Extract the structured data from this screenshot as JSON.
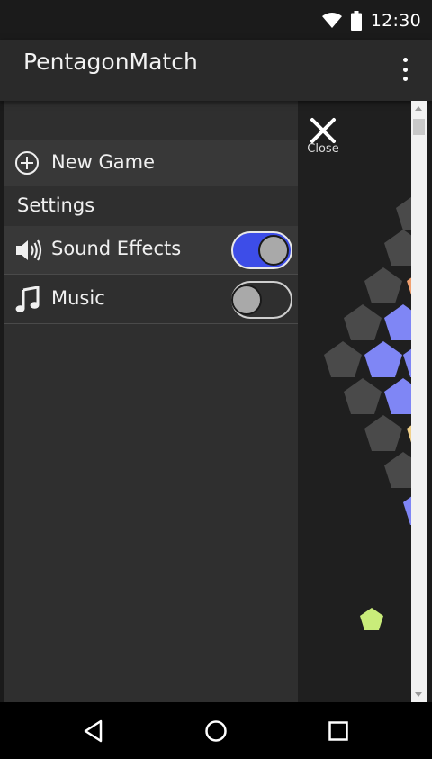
{
  "status_bar": {
    "time": "12:30",
    "icons": [
      "wifi-icon",
      "battery-icon"
    ]
  },
  "app_bar": {
    "title": "PentagonMatch",
    "overflow_icon": "more-vert-icon"
  },
  "drawer": {
    "new_game_label": "New Game",
    "new_game_icon": "add-circle-icon",
    "settings_label": "Settings",
    "sound_effects": {
      "label": "Sound Effects",
      "icon": "speaker-icon",
      "enabled": true
    },
    "music": {
      "label": "Music",
      "icon": "music-note-icon",
      "enabled": false
    }
  },
  "close": {
    "label": "Close",
    "icon": "close-icon"
  },
  "colors": {
    "toggle_on": "#3d4de8",
    "pentagon_gray": "#4a4a4a",
    "pentagon_blue": "#7f86f5",
    "pentagon_orange": "#f0a070",
    "pentagon_lime": "#c9ec7a"
  },
  "nav_bar": {
    "icons": [
      "back-icon",
      "home-icon",
      "recents-icon"
    ]
  }
}
